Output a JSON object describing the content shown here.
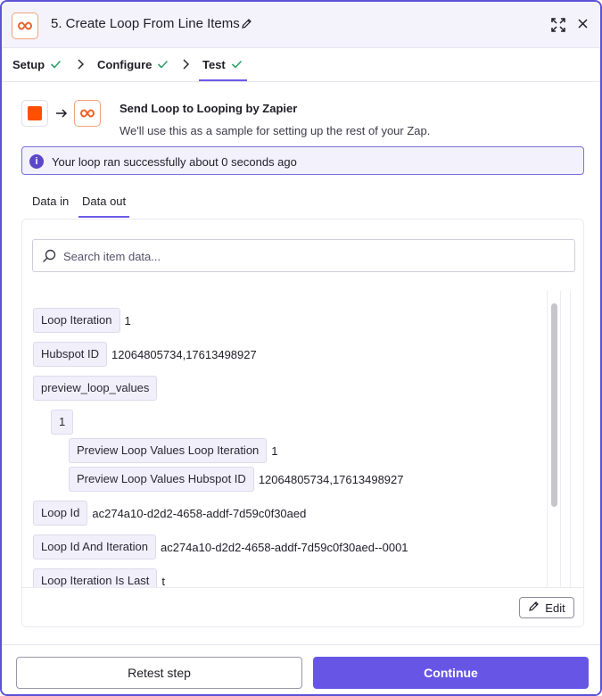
{
  "header": {
    "title": "5. Create Loop From Line Items",
    "icons": [
      "looping-logo-icon",
      "pencil-icon",
      "expand-icon",
      "close-icon"
    ]
  },
  "steps": [
    {
      "label": "Setup",
      "complete": true
    },
    {
      "label": "Configure",
      "complete": true
    },
    {
      "label": "Test",
      "complete": true,
      "active": true
    }
  ],
  "sample": {
    "title": "Send Loop to Looping by Zapier",
    "subtitle": "We'll use this as a sample for setting up the rest of your Zap."
  },
  "banner": {
    "text": "Your loop ran successfully about 0 seconds ago"
  },
  "data_tabs": [
    {
      "label": "Data in",
      "active": false
    },
    {
      "label": "Data out",
      "active": true
    }
  ],
  "search": {
    "placeholder": "Search item data..."
  },
  "fields": [
    {
      "key": "Loop Iteration",
      "value": "1"
    },
    {
      "key": "Hubspot ID",
      "value": "12064805734,17613498927"
    },
    {
      "key": "preview_loop_values",
      "value": ""
    },
    {
      "key": "1",
      "value": ""
    },
    {
      "key": "Preview Loop Values Loop Iteration",
      "value": "1"
    },
    {
      "key": "Preview Loop Values Hubspot ID",
      "value": "12064805734,17613498927"
    },
    {
      "key": "Loop Id",
      "value": "ac274a10-d2d2-4658-addf-7d59c0f30aed"
    },
    {
      "key": "Loop Id And Iteration",
      "value": "ac274a10-d2d2-4658-addf-7d59c0f30aed--0001"
    },
    {
      "key": "Loop Iteration Is Last",
      "value": "t"
    }
  ],
  "card_footer": {
    "edit_label": "Edit"
  },
  "footer": {
    "retest_label": "Retest step",
    "continue_label": "Continue"
  },
  "colors": {
    "accent": "#6756e6",
    "border_accent": "#5b53d6",
    "success_check": "#2f9e6a",
    "zapier_orange": "#ff4f00",
    "looping_orange": "#e8632b"
  }
}
